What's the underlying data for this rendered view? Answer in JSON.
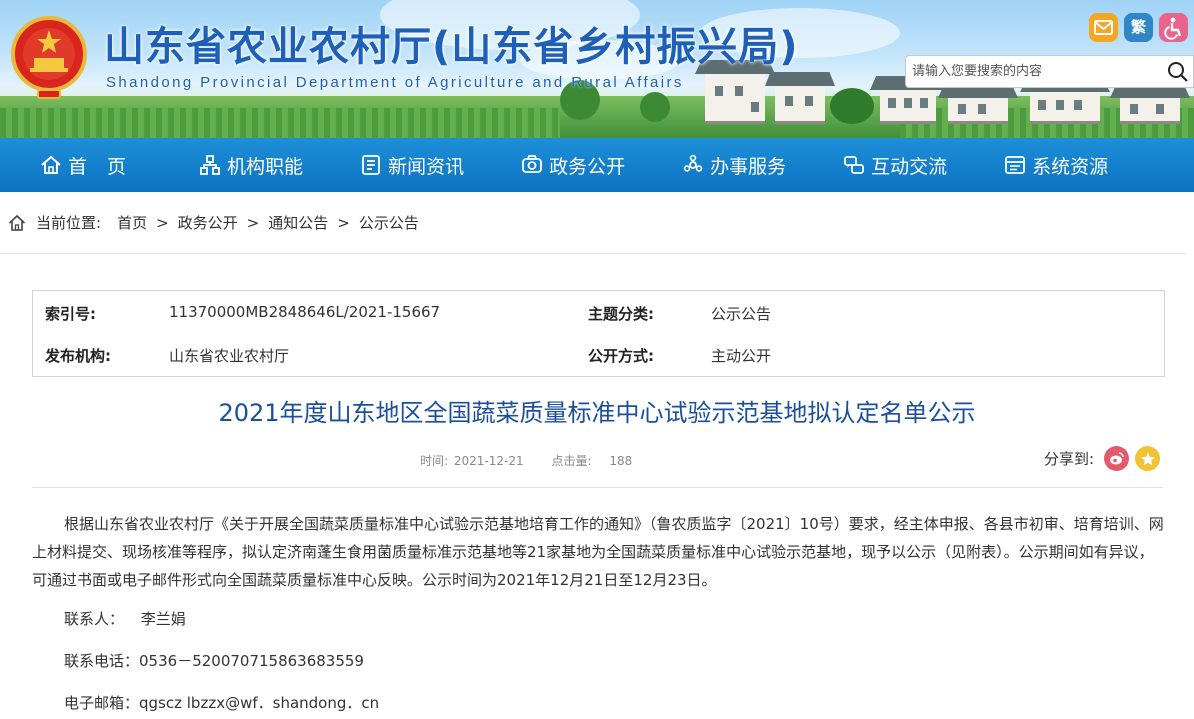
{
  "header": {
    "title_cn": "山东省农业农村厅(山东省乡村振兴局)",
    "title_en": "Shandong Provincial Department of Agriculture and Rural Affairs",
    "top_icons": {
      "mail": "mail-icon",
      "traditional": "繁",
      "accessibility": "accessibility-icon"
    },
    "search": {
      "placeholder": "请输入您要搜索的内容"
    }
  },
  "nav": {
    "items": [
      {
        "label": "首 页",
        "icon": "home-icon"
      },
      {
        "label": "机构职能",
        "icon": "org-icon"
      },
      {
        "label": "新闻资讯",
        "icon": "news-icon"
      },
      {
        "label": "政务公开",
        "icon": "gov-icon"
      },
      {
        "label": "办事服务",
        "icon": "service-icon"
      },
      {
        "label": "互动交流",
        "icon": "interaction-icon"
      },
      {
        "label": "系统资源",
        "icon": "resource-icon"
      }
    ]
  },
  "breadcrumb": {
    "prefix": "当前位置:",
    "items": [
      "首页",
      "政务公开",
      "通知公告",
      "公示公告"
    ],
    "separator": ">"
  },
  "meta": {
    "index_label": "索引号:",
    "index_value": "11370000MB2848646L/2021-15667",
    "topic_label": "主题分类:",
    "topic_value": "公示公告",
    "publisher_label": "发布机构:",
    "publisher_value": "山东省农业农村厅",
    "method_label": "公开方式:",
    "method_value": "主动公开"
  },
  "article": {
    "title": "2021年度山东地区全国蔬菜质量标准中心试验示范基地拟认定名单公示",
    "time_label": "时间:",
    "time_value": "2021-12-21",
    "clicks_label": "点击量:",
    "clicks_value": "188",
    "share_label": "分享到:",
    "paragraph": "根据山东省农业农村厅《关于开展全国蔬菜质量标准中心试验示范基地培育工作的通知》（鲁农质监字〔2021〕10号）要求，经主体申报、各县市初审、培育培训、网上材料提交、现场核准等程序，拟认定济南蓬生食用菌质量标准示范基地等21家基地为全国蔬菜质量标准中心试验示范基地，现予以公示（见附表）。公示期间如有异议，可通过书面或电子邮件形式向全国蔬菜质量标准中心反映。公示时间为2021年12月21日至12月23日。",
    "contact_label": "联系人：",
    "contact_value": "李兰娟",
    "phone_label": "联系电话：",
    "phone_value": "0536－520070715863683559",
    "email_label": "电子邮箱：",
    "email_value": "qgscz lbzzx@wf．shandong．cn"
  },
  "colors": {
    "nav_blue": "#0b73c2",
    "title_blue": "#1b4f9c",
    "header_blue": "#1e5fb8"
  }
}
